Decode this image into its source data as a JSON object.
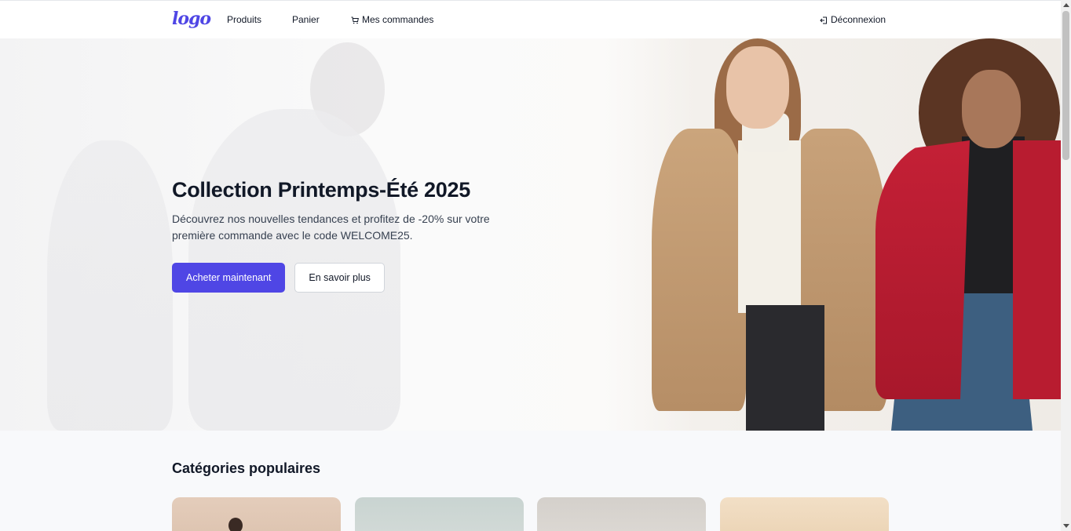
{
  "nav": {
    "logo": "logo",
    "products": "Produits",
    "cart": "Panier",
    "orders": "Mes commandes",
    "logout": "Déconnexion"
  },
  "hero": {
    "title": "Collection Printemps-Été 2025",
    "subtitle": "Découvrez nos nouvelles tendances et profitez de -20% sur votre première commande avec le code WELCOME25.",
    "primary_button": "Acheter maintenant",
    "secondary_button": "En savoir plus"
  },
  "categories": {
    "title": "Catégories populaires"
  },
  "icons": {
    "cart": "cart-icon",
    "logout": "logout-icon"
  },
  "colors": {
    "accent": "#4f46e5",
    "text": "#111827"
  }
}
